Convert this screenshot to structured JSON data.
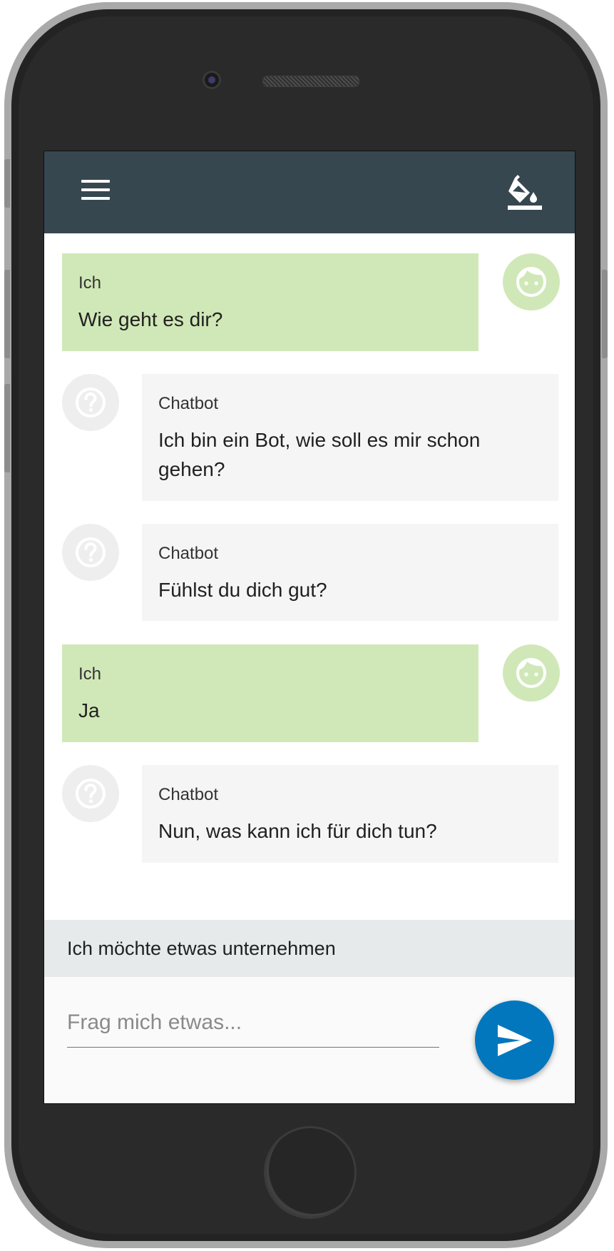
{
  "app_bar": {
    "menu_icon": "menu-icon",
    "theme_icon": "format-color-fill-icon",
    "background": "#37474f"
  },
  "messages": [
    {
      "sender": "Ich",
      "text": "Wie geht es dir?",
      "role": "user"
    },
    {
      "sender": "Chatbot",
      "text": "Ich bin ein Bot, wie soll es mir schon gehen?",
      "role": "bot"
    },
    {
      "sender": "Chatbot",
      "text": "Fühlst du dich gut?",
      "role": "bot"
    },
    {
      "sender": "Ich",
      "text": "Ja",
      "role": "user"
    },
    {
      "sender": "Chatbot",
      "text": "Nun, was kann ich für dich tun?",
      "role": "bot"
    }
  ],
  "suggestion": {
    "label": "Ich möchte etwas unternehmen"
  },
  "composer": {
    "placeholder": "Frag mich etwas...",
    "value": "",
    "send_icon": "send-icon"
  },
  "colors": {
    "user_bubble": "#d0e8b7",
    "bot_bubble": "#f5f5f5",
    "send_button": "#0277bd"
  }
}
